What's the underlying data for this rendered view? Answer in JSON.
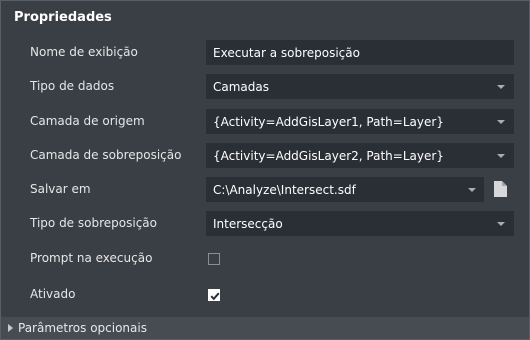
{
  "panel": {
    "title": "Propriedades"
  },
  "properties": {
    "display_name": {
      "label": "Nome de exibição",
      "value": "Executar a sobreposição"
    },
    "data_type": {
      "label": "Tipo de dados",
      "value": "Camadas"
    },
    "source_layer": {
      "label": "Camada de origem",
      "value": "{Activity=AddGisLayer1, Path=Layer}"
    },
    "overlay_layer": {
      "label": "Camada de sobreposição",
      "value": "{Activity=AddGisLayer2, Path=Layer}"
    },
    "save_in": {
      "label": "Salvar em",
      "value": "C:\\Analyze\\Intersect.sdf"
    },
    "overlay_type": {
      "label": "Tipo de sobreposição",
      "value": "Intersecção"
    },
    "prompt_on_run": {
      "label": "Prompt na execução",
      "checked": false
    },
    "enabled": {
      "label": "Ativado",
      "checked": true
    }
  },
  "footer": {
    "optional_params_label": "Parâmetros opcionais"
  },
  "icons": {
    "dropdown": "chevron-down-icon",
    "file": "file-icon",
    "expand": "triangle-right-icon"
  }
}
